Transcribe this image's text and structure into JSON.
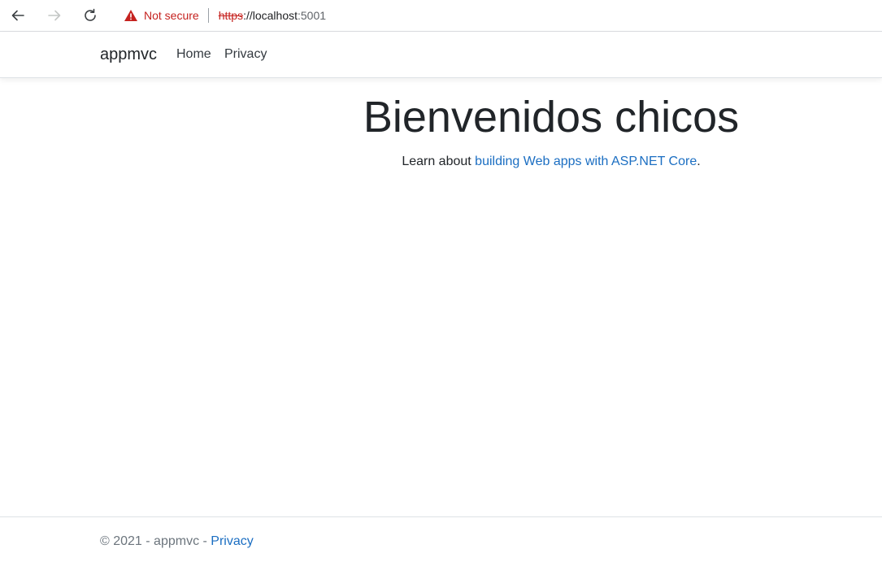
{
  "browser": {
    "security_label": "Not secure",
    "url_scheme": "https",
    "url_separator": "://",
    "url_host": "localhost",
    "url_port": ":5001",
    "colors": {
      "warning": "#c5221f",
      "icon_gray": "#5f6368"
    },
    "icons": [
      "back-arrow-icon",
      "forward-arrow-icon",
      "reload-icon",
      "warning-icon"
    ]
  },
  "navbar": {
    "brand": "appmvc",
    "links": [
      {
        "label": "Home"
      },
      {
        "label": "Privacy"
      }
    ]
  },
  "main": {
    "title": "Bienvenidos chicos",
    "lead_prefix": "Learn about ",
    "lead_link": "building Web apps with ASP.NET Core",
    "lead_suffix": "."
  },
  "footer": {
    "copyright": "© 2021 - appmvc - ",
    "privacy_link": "Privacy"
  },
  "theme": {
    "link_color": "#1b6ec2",
    "text_color": "#212529",
    "muted_color": "#6c757d"
  }
}
